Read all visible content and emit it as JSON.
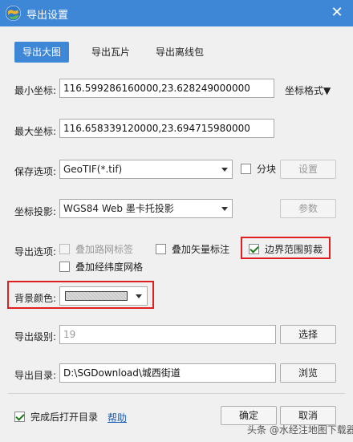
{
  "window": {
    "title": "导出设置",
    "close_glyph": "✕"
  },
  "tabs": [
    {
      "label": "导出大图"
    },
    {
      "label": "导出瓦片"
    },
    {
      "label": "导出离线包"
    }
  ],
  "min_coord": {
    "label": "最小坐标:",
    "value": "116.599286160000,23.628249000000"
  },
  "coord_format": {
    "label": "坐标格式▼"
  },
  "max_coord": {
    "label": "最大坐标:",
    "value": "116.658339120000,23.694715980000"
  },
  "save_option": {
    "label": "保存选项:",
    "value": "GeoTIF(*.tif)",
    "tile_label": "分块",
    "settings_label": "设置"
  },
  "projection": {
    "label": "坐标投影:",
    "value": "WGS84 Web 墨卡托投影",
    "params_label": "参数"
  },
  "export_options": {
    "label": "导出选项:",
    "road_labels": "叠加路网标签",
    "vector_labels": "叠加矢量标注",
    "clip": "边界范围剪裁",
    "graticule": "叠加经纬度网格"
  },
  "bg_color": {
    "label": "背景颜色:"
  },
  "export_level": {
    "label": "导出级别:",
    "value": "19",
    "choose_label": "选择"
  },
  "export_dir": {
    "label": "导出目录:",
    "value": "D:\\SGDownload\\城西街道",
    "browse_label": "浏览"
  },
  "footer": {
    "open_after": "完成后打开目录",
    "help": "帮助",
    "ok": "确定",
    "cancel": "取消"
  },
  "watermark": "头条 @水经注地图下载器",
  "colors": {
    "accent": "#3e86d6",
    "highlight": "#e02020"
  }
}
